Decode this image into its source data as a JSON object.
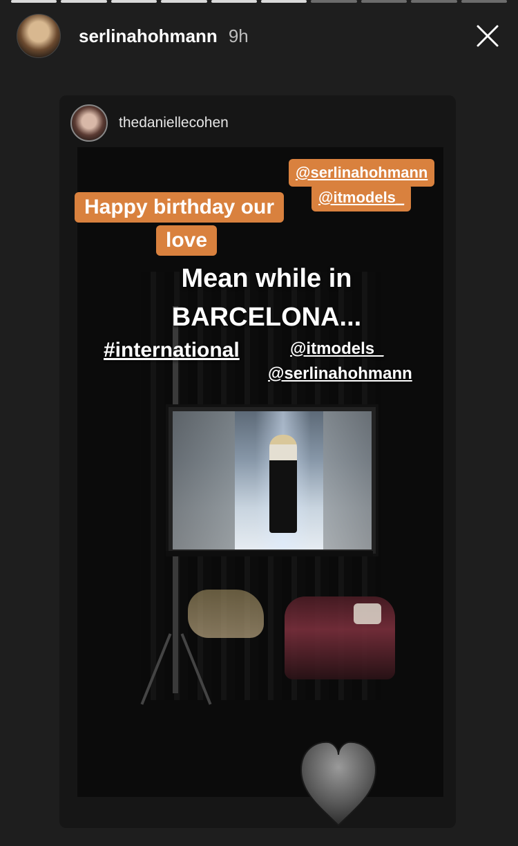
{
  "story": {
    "progress_segments_total": 10,
    "progress_segments_completed": 6,
    "username": "serlinahohmann",
    "time_ago": "9h"
  },
  "repost": {
    "username": "thedaniellecohen"
  },
  "overlays": {
    "tag_mention_1": "@serlinahohmann",
    "tag_mention_2": "@itmodels_",
    "tag_birthday_line1": "Happy birthday our",
    "tag_birthday_line2": "love",
    "headline_line1": "Mean while in",
    "headline_line2": "BARCELONA...",
    "hashtag": "#international",
    "mention_text_1": "@itmodels_",
    "mention_text_2": "@serlinahohmann"
  },
  "icons": {
    "close": "close-icon",
    "heart": "heart-icon"
  },
  "colors": {
    "tag_orange": "#d9813e",
    "heart_gray": "#6a6a6a"
  }
}
